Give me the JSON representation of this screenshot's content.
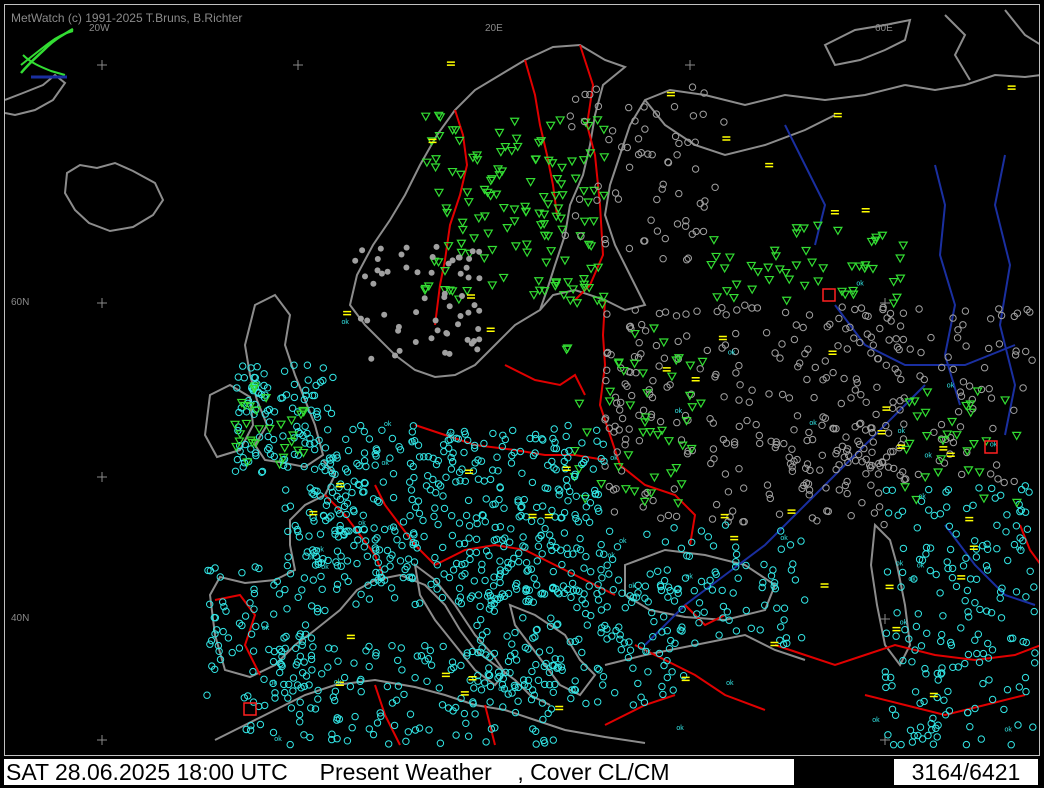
{
  "credit": "MetWatch  (c) 1991-2025 T.Bruns, B.Richter",
  "grid_labels": {
    "lon_20w": "20W",
    "lon_20e": "20E",
    "lon_60e": "60E",
    "lat_60n": "60N",
    "lat_40n": "40N"
  },
  "status": {
    "datetime": "SAT 28.06.2025 18:00 UTC",
    "product": "Present Weather",
    "cover": ", Cover CL/CM",
    "count": "3164/6421"
  },
  "station_text": "ok",
  "colors": {
    "background": "#000000",
    "coast": "#8c8c8c",
    "border": "#e00000",
    "river": "#1a2fa0",
    "clear_station": "#33e6e6",
    "rain_station": "#33dd33",
    "overcast_station": "#a0a0a0",
    "fog_station": "#ffff00",
    "thunder_station": "#ff2020"
  }
}
